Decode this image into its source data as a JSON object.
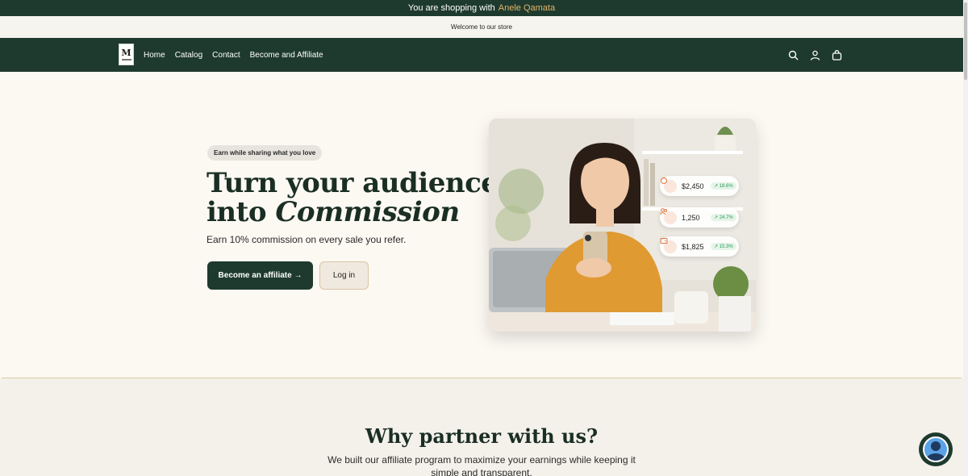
{
  "announcement": {
    "prefix": "You are shopping with",
    "name": "Anele Qamata"
  },
  "welcome": "Welcome to our store",
  "nav": {
    "logo_letter": "M",
    "items": [
      "Home",
      "Catalog",
      "Contact",
      "Become and Affiliate"
    ],
    "icons": [
      "search-icon",
      "account-icon",
      "cart-icon"
    ]
  },
  "hero": {
    "pill": "Earn while sharing what you love",
    "headline_line1": "Turn your audience",
    "headline_line2_plain": "into",
    "headline_line2_italic": "Commission",
    "subline": "Earn 10% commission on every sale you refer.",
    "primary_button": "Become an affiliate →",
    "secondary_button": "Log in",
    "stats": [
      {
        "value": "$2,450",
        "change": "↗ 18.6%",
        "icon": "money-bag-icon"
      },
      {
        "value": "1,250",
        "change": "↗ 24.7%",
        "icon": "users-icon"
      },
      {
        "value": "$1,825",
        "change": "↗ 15.3%",
        "icon": "wallet-icon"
      }
    ]
  },
  "why": {
    "title": "Why partner with us?",
    "text": "We built our affiliate program to maximize your earnings while keeping it simple and transparent."
  },
  "colors": {
    "brand_green": "#1e3a2e",
    "accent_gold": "#e2b467",
    "background": "#fcf8f2"
  }
}
